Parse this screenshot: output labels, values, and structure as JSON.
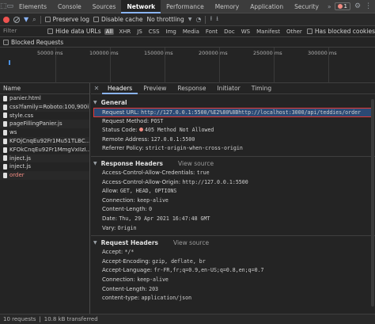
{
  "devtools_tabs": [
    "Elements",
    "Console",
    "Sources",
    "Network",
    "Performance",
    "Memory",
    "Application",
    "Security"
  ],
  "active_tab": "Network",
  "error_count": "1",
  "toolbar": {
    "preserve_log": "Preserve log",
    "disable_cache": "Disable cache",
    "throttling": "No throttling"
  },
  "filter": {
    "placeholder": "Filter",
    "hide_data_urls": "Hide data URLs",
    "types": [
      "All",
      "XHR",
      "JS",
      "CSS",
      "Img",
      "Media",
      "Font",
      "Doc",
      "WS",
      "Manifest",
      "Other"
    ],
    "has_blocked_cookies": "Has blocked cookies",
    "blocked_requests": "Blocked Requests"
  },
  "timeline_ticks": [
    "50000 ms",
    "100000 ms",
    "150000 ms",
    "200000 ms",
    "250000 ms",
    "300000 ms"
  ],
  "list": {
    "header": "Name",
    "rows": [
      "panier.html",
      "css?family=Roboto:100,900i",
      "style.css",
      "pageFillingPanier.js",
      "ws",
      "KFOjCnqEu92Fr1Mu51TLBC...",
      "KFOkCnqEu92Fr1MmgVxIIzI...",
      "inject.js",
      "inject.js",
      "order"
    ]
  },
  "detail_tabs": [
    "Headers",
    "Preview",
    "Response",
    "Initiator",
    "Timing"
  ],
  "general": {
    "title": "General",
    "items": [
      {
        "k": "Request URL:",
        "v": "http://127.0.0.1:5500/%E2%80%8Bhttp://localhost:3000/api/teddies/order"
      },
      {
        "k": "Request Method:",
        "v": "POST"
      },
      {
        "k": "Status Code:",
        "v": "405 Method Not Allowed"
      },
      {
        "k": "Remote Address:",
        "v": "127.0.0.1:5500"
      },
      {
        "k": "Referrer Policy:",
        "v": "strict-origin-when-cross-origin"
      }
    ]
  },
  "response_headers": {
    "title": "Response Headers",
    "view_source": "View source",
    "items": [
      {
        "k": "Access-Control-Allow-Credentials:",
        "v": "true"
      },
      {
        "k": "Access-Control-Allow-Origin:",
        "v": "http://127.0.0.1:5500"
      },
      {
        "k": "Allow:",
        "v": "GET, HEAD, OPTIONS"
      },
      {
        "k": "Connection:",
        "v": "keep-alive"
      },
      {
        "k": "Content-Length:",
        "v": "0"
      },
      {
        "k": "Date:",
        "v": "Thu, 29 Apr 2021 16:47:48 GMT"
      },
      {
        "k": "Vary:",
        "v": "Origin"
      }
    ]
  },
  "request_headers": {
    "title": "Request Headers",
    "view_source": "View source",
    "items": [
      {
        "k": "Accept:",
        "v": "*/*"
      },
      {
        "k": "Accept-Encoding:",
        "v": "gzip, deflate, br"
      },
      {
        "k": "Accept-Language:",
        "v": "fr-FR,fr;q=0.9,en-US;q=0.8,en;q=0.7"
      },
      {
        "k": "Connection:",
        "v": "keep-alive"
      },
      {
        "k": "Content-Length:",
        "v": "203"
      },
      {
        "k": "content-type:",
        "v": "application/json"
      }
    ]
  },
  "status": {
    "requests": "10 requests",
    "transferred": "10.8 kB transferred"
  }
}
